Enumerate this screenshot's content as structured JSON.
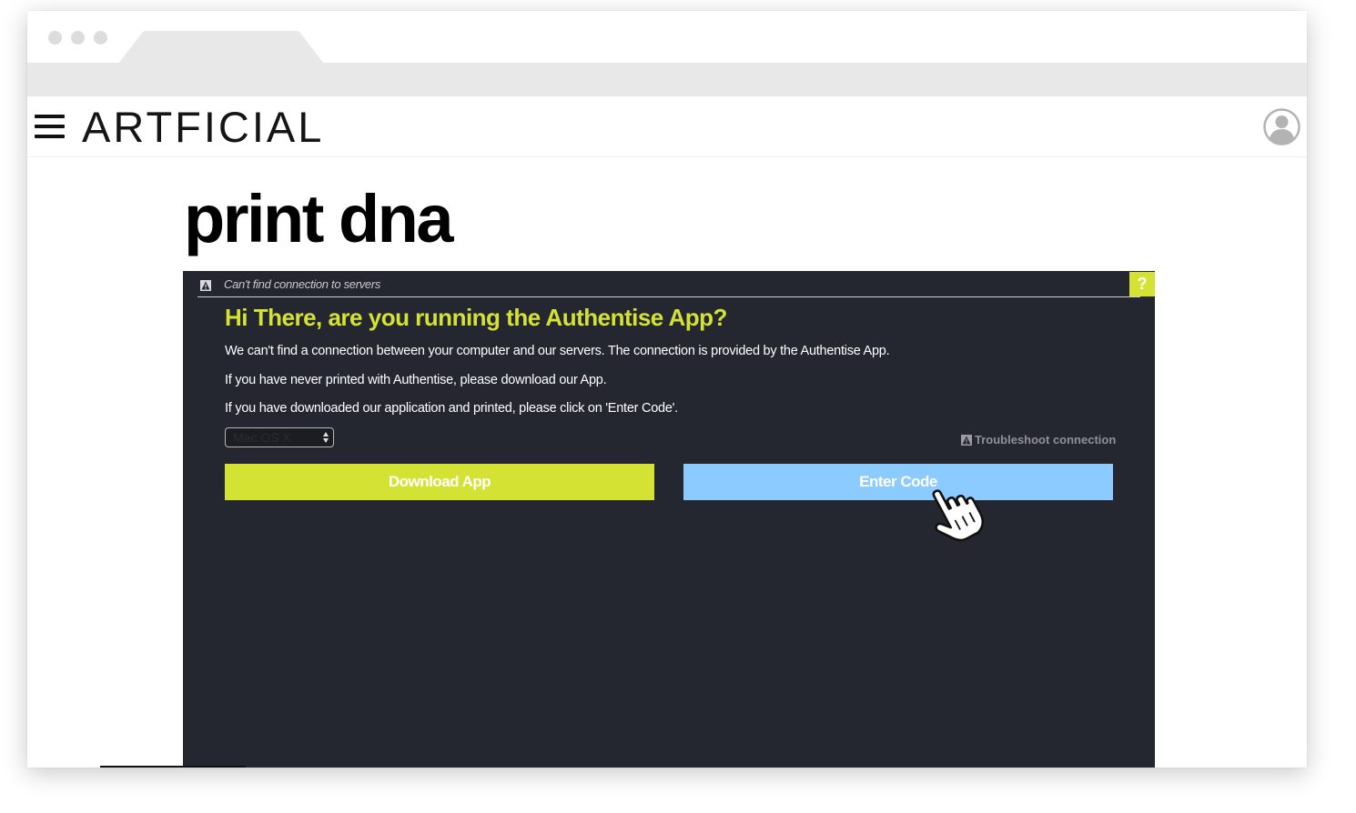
{
  "header": {
    "brand": "ARTFICIAL",
    "menu_icon": "hamburger-menu-icon",
    "account_icon": "user-avatar-icon"
  },
  "page": {
    "title": "print dna"
  },
  "dialog": {
    "status_text": "Can't find connection to servers",
    "help_label": "?",
    "heading": "Hi There, are you running the Authentise App?",
    "paragraphs": [
      "We can't find a connection between your computer and our servers. The connection is provided by the Authentise App.",
      "If you have never printed with Authentise, please download our App.",
      "If you have downloaded our application and printed, please click on 'Enter Code'."
    ],
    "os_select": {
      "selected": "Mac OS X"
    },
    "troubleshoot_label": "Troubleshoot connection",
    "download_label": "Download App",
    "enter_code_label": "Enter Code"
  },
  "colors": {
    "accent_lime": "#d4e234",
    "accent_blue": "#8ccbff",
    "panel_bg": "#242730",
    "chrome_gray": "#e8e8e8"
  }
}
